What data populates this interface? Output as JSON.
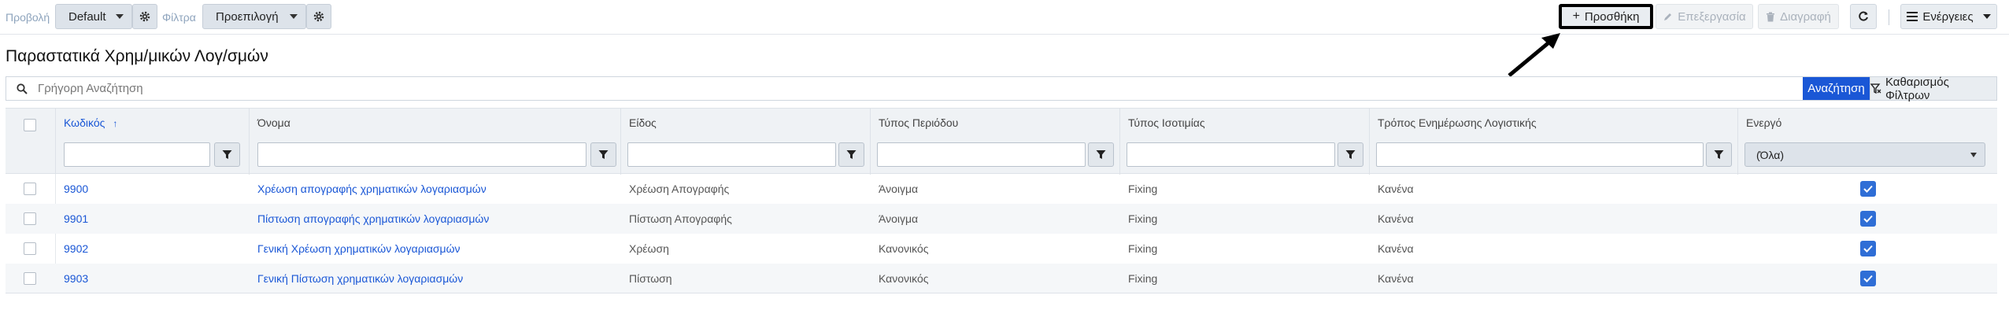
{
  "toolbar": {
    "view_label": "Προβολή",
    "view_value": "Default",
    "filter_label": "Φίλτρα",
    "filter_value": "Προεπιλογή",
    "add_label": "Προσθήκη",
    "edit_label": "Επεξεργασία",
    "delete_label": "Διαγραφή",
    "actions_label": "Ενέργειες"
  },
  "page": {
    "title": "Παραστατικά Χρημ/μικών Λογ/σμών"
  },
  "search": {
    "placeholder": "Γρήγορη Αναζήτηση",
    "value": "",
    "search_button": "Αναζήτηση",
    "clear_button": "Καθαρισμός Φίλτρων"
  },
  "grid": {
    "columns": [
      "Κωδικός",
      "Όνομα",
      "Είδος",
      "Τύπος Περιόδου",
      "Τύπος Ισοτιμίας",
      "Τρόπος Ενημέρωσης Λογιστικής",
      "Ενεργό"
    ],
    "sort_column": "Κωδικός",
    "active_filter_value": "(Όλα)",
    "rows": [
      {
        "code": "9900",
        "name": "Χρέωση απογραφής χρηματικών λογαριασμών",
        "kind": "Χρέωση Απογραφής",
        "period": "Άνοιγμα",
        "rate": "Fixing",
        "update": "Κανένα",
        "active": true
      },
      {
        "code": "9901",
        "name": "Πίστωση απογραφής χρηματικών λογαριασμών",
        "kind": "Πίστωση Απογραφής",
        "period": "Άνοιγμα",
        "rate": "Fixing",
        "update": "Κανένα",
        "active": true
      },
      {
        "code": "9902",
        "name": "Γενική Χρέωση χρηματικών λογαριασμών",
        "kind": "Χρέωση",
        "period": "Κανονικός",
        "rate": "Fixing",
        "update": "Κανένα",
        "active": true
      },
      {
        "code": "9903",
        "name": "Γενική Πίστωση χρηματικών λογαριασμών",
        "kind": "Πίστωση",
        "period": "Κανονικός",
        "rate": "Fixing",
        "update": "Κανένα",
        "active": true
      }
    ]
  },
  "colors": {
    "accent": "#1a57d6",
    "checkbox_on": "#2f6ed6",
    "highlight_border": "#000000"
  }
}
